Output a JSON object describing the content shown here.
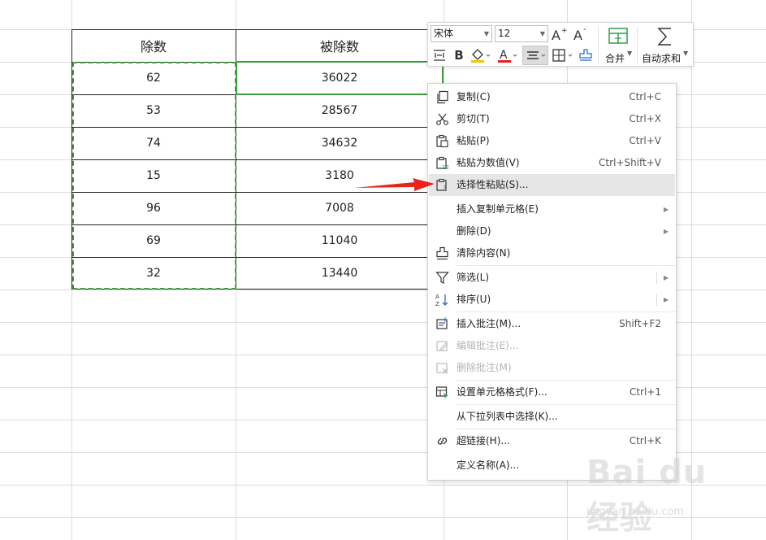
{
  "table": {
    "headers": [
      "除数",
      "被除数"
    ],
    "rows": [
      [
        "62",
        "36022"
      ],
      [
        "53",
        "28567"
      ],
      [
        "74",
        "34632"
      ],
      [
        "15",
        "3180"
      ],
      [
        "96",
        "7008"
      ],
      [
        "69",
        "11040"
      ],
      [
        "32",
        "13440"
      ]
    ]
  },
  "mini_toolbar": {
    "font_name": "宋体",
    "font_size": "12",
    "merge_label": "合并",
    "autosum_label": "自动求和",
    "font_color": "#e02020",
    "fill_color": "#f2c500",
    "merge_icon_color": "#2e9e4a"
  },
  "context_menu": {
    "items": [
      {
        "label": "复制(C)",
        "shortcut": "Ctrl+C",
        "icon": "copy-icon"
      },
      {
        "label": "剪切(T)",
        "shortcut": "Ctrl+X",
        "icon": "scissors-icon"
      },
      {
        "label": "粘贴(P)",
        "shortcut": "Ctrl+V",
        "icon": "paste-icon"
      },
      {
        "label": "粘贴为数值(V)",
        "shortcut": "Ctrl+Shift+V",
        "icon": "paste-values-icon"
      },
      {
        "label": "选择性粘贴(S)...",
        "shortcut": "",
        "icon": "paste-special-icon",
        "highlighted": true
      },
      {
        "label": "插入复制单元格(E)",
        "shortcut": "",
        "icon": "",
        "submenu": true
      },
      {
        "label": "删除(D)",
        "shortcut": "",
        "icon": "",
        "submenu": true
      },
      {
        "label": "清除内容(N)",
        "shortcut": "",
        "icon": "eraser-icon"
      },
      {
        "label": "筛选(L)",
        "shortcut": "",
        "icon": "filter-icon",
        "submenu": true
      },
      {
        "label": "排序(U)",
        "shortcut": "",
        "icon": "sort-icon",
        "submenu": true
      },
      {
        "label": "插入批注(M)...",
        "shortcut": "Shift+F2",
        "icon": "insert-comment-icon"
      },
      {
        "label": "编辑批注(E)...",
        "shortcut": "",
        "icon": "edit-comment-icon",
        "disabled": true
      },
      {
        "label": "删除批注(M)",
        "shortcut": "",
        "icon": "delete-comment-icon",
        "disabled": true
      },
      {
        "label": "设置单元格格式(F)...",
        "shortcut": "Ctrl+1",
        "icon": "format-cells-icon"
      },
      {
        "label": "从下拉列表中选择(K)...",
        "shortcut": "",
        "icon": ""
      },
      {
        "label": "超链接(H)...",
        "shortcut": "Ctrl+K",
        "icon": "link-icon"
      },
      {
        "label": "定义名称(A)...",
        "shortcut": "",
        "icon": ""
      }
    ]
  },
  "annotation": {
    "color": "#e8241c"
  },
  "watermark": {
    "logo": "Bai du 经验",
    "url": "jingyan.baidu.com"
  }
}
